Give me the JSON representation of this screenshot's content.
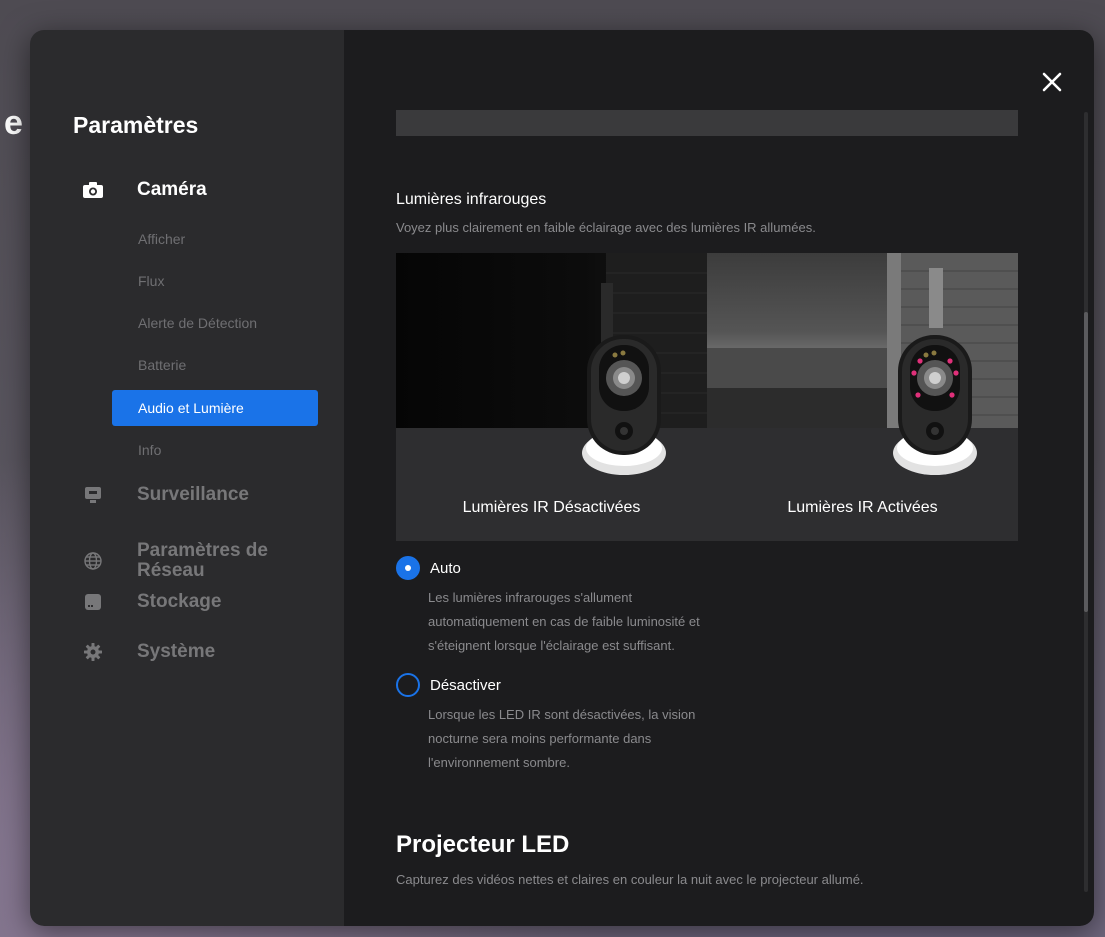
{
  "sidebar": {
    "title": "Paramètres",
    "sections": [
      {
        "label": "Caméra",
        "icon": "camera-icon",
        "active": true
      },
      {
        "label": "Surveillance",
        "icon": "monitor-icon",
        "active": false
      },
      {
        "label": "Paramètres de Réseau",
        "icon": "globe-icon",
        "active": false
      },
      {
        "label": "Stockage",
        "icon": "storage-icon",
        "active": false
      },
      {
        "label": "Système",
        "icon": "gear-icon",
        "active": false
      }
    ],
    "camera_subitems": [
      {
        "label": "Afficher",
        "selected": false
      },
      {
        "label": "Flux",
        "selected": false
      },
      {
        "label": "Alerte de Détection",
        "selected": false
      },
      {
        "label": "Batterie",
        "selected": false
      },
      {
        "label": "Audio et Lumière",
        "selected": true
      },
      {
        "label": "Info",
        "selected": false
      }
    ]
  },
  "content": {
    "ir": {
      "title": "Lumières infrarouges",
      "description": "Voyez plus clairement en faible éclairage avec des lumières IR allumées.",
      "image_caption_off": "Lumières IR Désactivées",
      "image_caption_on": "Lumières IR Activées",
      "options": [
        {
          "label": "Auto",
          "checked": true,
          "description_lines": [
            "Les lumières infrarouges s'allument",
            "automatiquement en cas de faible luminosité et",
            "s'éteignent lorsque l'éclairage est suffisant."
          ]
        },
        {
          "label": "Désactiver",
          "checked": false,
          "description_lines": [
            "Lorsque les LED IR sont désactivées, la vision",
            "nocturne sera moins performante dans",
            "l'environnement sombre."
          ]
        }
      ]
    },
    "led": {
      "title": "Projecteur LED",
      "description": "Capturez des vidéos nettes et claires en couleur la nuit avec le projecteur allumé."
    }
  },
  "colors": {
    "accent": "#1a73e8",
    "sidebar_bg": "#2b2b2d",
    "content_bg": "#1c1c1e",
    "ir_led": "#e0307a"
  }
}
